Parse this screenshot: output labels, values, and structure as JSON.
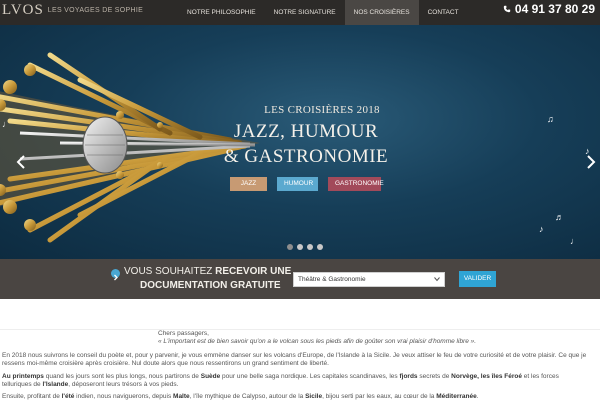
{
  "header": {
    "logo_mark": "LVOS",
    "logo_text": "LES VOYAGES DE SOPHIE",
    "nav": [
      "NOTRE PHILOSOPHIE",
      "NOTRE SIGNATURE",
      "NOS CROISIÈRES",
      "CONTACT"
    ],
    "active_nav_index": 2,
    "phone": "04 91 37 80 29",
    "phone_icon": "phone-icon"
  },
  "hero": {
    "subtitle": "LES CROISIÈRES 2018",
    "title_line1": "JAZZ, HUMOUR",
    "title_line2": "& GASTRONOMIE",
    "tags": [
      "JAZZ",
      "HUMOUR",
      "GASTRONOMIE"
    ],
    "slider_dots": 4,
    "active_dot": 0,
    "colors": {
      "jazz": "#c79a73",
      "humour": "#5ba9cf",
      "gastronomie": "#a24a5a"
    }
  },
  "documentation": {
    "line1_prefix": "VOUS SOUHAITEZ ",
    "line1_bold": "RECEVOIR UNE",
    "line2": "DOCUMENTATION GRATUITE",
    "select_value": "Théâtre & Gastronomie",
    "submit_label": "VALIDER"
  },
  "content": {
    "greeting": "Chers passagers,",
    "quote": "« L'important est de bien savoir qu'on a le volcan sous les pieds afin de goûter son vrai plaisir d'homme libre ».",
    "p1_line1": "En 2018 nous suivrons le conseil du poète et, pour y parvenir, je vous emmène danser sur les volcans d'Europe, de l'Islande à la Sicile. Je veux attiser le feu de votre curiosité et de votre plaisir. Ce que je",
    "p1_line2": "ressens moi-même croisière après croisière. Nul doute alors que nous ressentirons un grand sentiment de liberté.",
    "p2_a": "Au printemps",
    "p2_b": " quand les jours sont les plus longs, nous partirons de ",
    "p2_c": "Suède",
    "p2_d": " pour une belle saga nordique. Les capitales scandinaves, les ",
    "p2_e": "fjords",
    "p2_f": " secrets de ",
    "p2_g": "Norvège, les îles Féroé",
    "p2_h": " et les forces",
    "p2_line2_a": "telluriques de ",
    "p2_line2_b": "l'Islande",
    "p2_line2_c": ", déposeront leurs trésors à vos pieds.",
    "p3_a": "Ensuite, profitant de ",
    "p3_b": "l'été",
    "p3_c": " indien, nous naviguerons, depuis ",
    "p3_d": "Malte",
    "p3_e": ", l'île mythique de Calypso, autour de la ",
    "p3_f": "Sicile",
    "p3_g": ", bijou serti par les eaux, au cœur de la ",
    "p3_h": "Méditerranée",
    "p3_i": "."
  }
}
